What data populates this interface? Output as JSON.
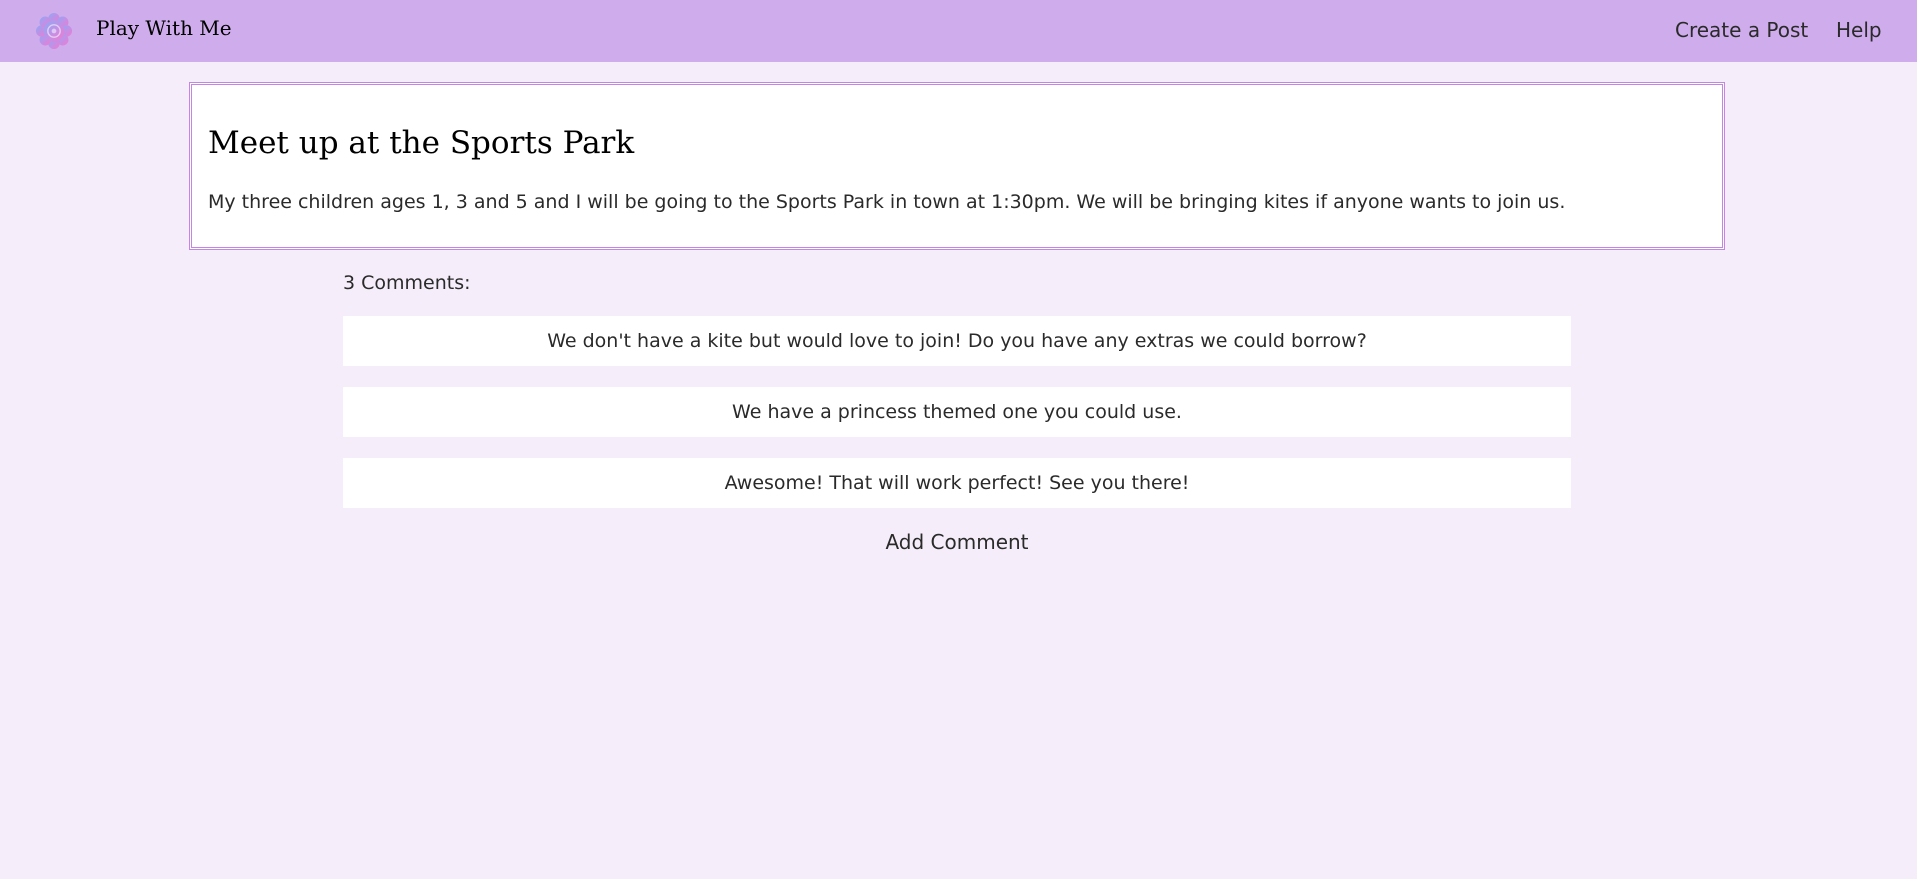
{
  "app": {
    "name": "Play With Me",
    "logo_icon": "flower-logo-icon"
  },
  "nav": {
    "create_post": "Create a Post",
    "help": "Help"
  },
  "post": {
    "title": "Meet up at the Sports Park",
    "body": "My three children ages 1, 3 and 5 and I will be going to the Sports Park in town at 1:30pm. We will be bringing kites if anyone wants to join us."
  },
  "comments": {
    "count_label": "3 Comments:",
    "items": [
      {
        "text": "We don't have a kite but would love to join! Do you have any extras we could borrow?"
      },
      {
        "text": "We have a princess themed one you could use."
      },
      {
        "text": "Awesome! That will work perfect! See you there!"
      }
    ],
    "add_label": "Add Comment"
  },
  "colors": {
    "navbar": "#cfaceb",
    "page_background": "#f5eefa",
    "card_border": "#c386e3",
    "card_background": "#ffffff"
  }
}
